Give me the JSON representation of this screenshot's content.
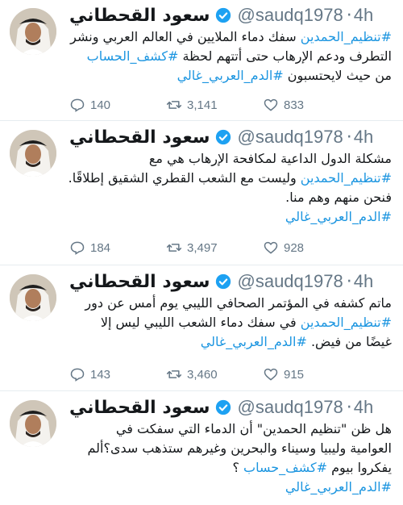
{
  "feed": {
    "tweets": [
      {
        "name": "سعود القحطاني",
        "handle": "@saudq1978",
        "dot": "·",
        "time": "4h",
        "lines": [
          [
            {
              "t": "ht",
              "v": "#تنظيم_الحمدين"
            },
            {
              "t": "tx",
              "v": " سفك دماء الملايين في العالم العربي ونشر"
            }
          ],
          [
            {
              "t": "tx",
              "v": "التطرف ودعم الإرهاب حتى أتتهم لحظة "
            },
            {
              "t": "ht",
              "v": "#كشف_الحساب"
            }
          ],
          [
            {
              "t": "tx",
              "v": "من حيث لايحتسبون "
            },
            {
              "t": "ht",
              "v": "#الدم_العربي_غالي"
            }
          ]
        ],
        "replies": "140",
        "retweets": "3,141",
        "likes": "833"
      },
      {
        "name": "سعود القحطاني",
        "handle": "@saudq1978",
        "dot": "·",
        "time": "4h",
        "lines": [
          [
            {
              "t": "tx",
              "v": "مشكلة الدول الداعية لمكافحة الإرهاب هي مع"
            }
          ],
          [
            {
              "t": "ht",
              "v": "#تنظيم_الحمدين"
            },
            {
              "t": "tx",
              "v": " وليست مع الشعب القطري الشقيق إطلاقًا."
            }
          ],
          [
            {
              "t": "tx",
              "v": "فنحن منهم وهم منا."
            }
          ],
          [
            {
              "t": "ht",
              "v": "#الدم_العربي_غالي"
            }
          ]
        ],
        "replies": "184",
        "retweets": "3,497",
        "likes": "928"
      },
      {
        "name": "سعود القحطاني",
        "handle": "@saudq1978",
        "dot": "·",
        "time": "4h",
        "lines": [
          [
            {
              "t": "tx",
              "v": "ماتم كشفه في المؤتمر الصحافي الليبي يوم أمس عن دور"
            }
          ],
          [
            {
              "t": "ht",
              "v": "#تنظيم_الحمدين"
            },
            {
              "t": "tx",
              "v": " في سفك دماء الشعب الليبي ليس إلا"
            }
          ],
          [
            {
              "t": "tx",
              "v": "غيضًا من فيض. "
            },
            {
              "t": "ht",
              "v": "#الدم_العربي_غالي"
            }
          ]
        ],
        "replies": "143",
        "retweets": "3,460",
        "likes": "915"
      },
      {
        "name": "سعود القحطاني",
        "handle": "@saudq1978",
        "dot": "·",
        "time": "4h",
        "lines": [
          [
            {
              "t": "tx",
              "v": "هل ظن \"تنظيم الحمدين\" أن الدماء التي سفكت في"
            }
          ],
          [
            {
              "t": "tx",
              "v": "العوامية وليبيا وسيناء والبحرين  وغيرهم ستذهب سدى؟ألم"
            }
          ],
          [
            {
              "t": "tx",
              "v": "يفكروا بيوم "
            },
            {
              "t": "ht",
              "v": "#كشف_حساب"
            },
            {
              "t": "tx",
              "v": " ؟"
            }
          ],
          [
            {
              "t": "ht",
              "v": "#الدم_العربي_غالي"
            }
          ]
        ],
        "replies": "",
        "retweets": "",
        "likes": ""
      }
    ]
  },
  "colors": {
    "accent": "#1b95e0",
    "muted": "#657786",
    "divider": "#e6ecf0",
    "verified": "#1da1f2"
  },
  "icons": [
    "reply-icon",
    "retweet-icon",
    "like-icon",
    "verified-badge-icon",
    "avatar"
  ]
}
